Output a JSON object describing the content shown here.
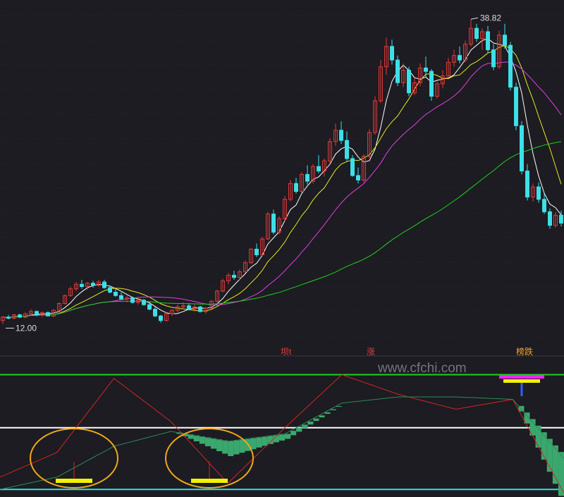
{
  "chart_data": [
    {
      "type": "candlestick",
      "title": "",
      "annotations": {
        "high_label": "38.82",
        "low_label": "12.00",
        "event_tags": [
          "坝t",
          "涨",
          "榜跌"
        ]
      },
      "ylim": [
        10,
        40
      ],
      "candles": [
        [
          12.2,
          12.6,
          11.9,
          12.5
        ],
        [
          12.5,
          12.7,
          12.3,
          12.4
        ],
        [
          12.4,
          12.8,
          12.3,
          12.7
        ],
        [
          12.7,
          12.8,
          12.4,
          12.5
        ],
        [
          12.5,
          12.9,
          12.4,
          12.8
        ],
        [
          12.8,
          13.2,
          12.6,
          13.0
        ],
        [
          13.0,
          13.1,
          12.6,
          12.7
        ],
        [
          12.7,
          13.0,
          12.5,
          12.9
        ],
        [
          12.9,
          13.0,
          12.6,
          12.6
        ],
        [
          12.6,
          13.2,
          12.5,
          13.1
        ],
        [
          13.1,
          13.8,
          13.0,
          13.7
        ],
        [
          13.7,
          14.5,
          13.6,
          14.4
        ],
        [
          14.4,
          15.2,
          14.3,
          15.0
        ],
        [
          15.0,
          15.6,
          14.8,
          15.4
        ],
        [
          15.4,
          15.8,
          15.0,
          15.2
        ],
        [
          15.2,
          15.6,
          14.9,
          15.5
        ],
        [
          15.5,
          15.7,
          15.1,
          15.3
        ],
        [
          15.3,
          15.8,
          15.2,
          15.6
        ],
        [
          15.6,
          15.8,
          15.0,
          15.1
        ],
        [
          15.1,
          15.3,
          14.6,
          14.7
        ],
        [
          14.7,
          15.0,
          14.3,
          14.4
        ],
        [
          14.4,
          14.7,
          14.0,
          14.1
        ],
        [
          14.1,
          14.4,
          13.8,
          14.2
        ],
        [
          14.2,
          14.3,
          13.7,
          13.8
        ],
        [
          13.8,
          14.2,
          13.6,
          14.0
        ],
        [
          14.0,
          14.1,
          13.5,
          13.6
        ],
        [
          13.6,
          13.9,
          13.1,
          13.2
        ],
        [
          13.2,
          13.4,
          12.5,
          12.6
        ],
        [
          12.6,
          12.7,
          12.0,
          12.2
        ],
        [
          12.2,
          12.9,
          12.1,
          12.8
        ],
        [
          12.8,
          13.2,
          12.6,
          13.1
        ],
        [
          13.1,
          13.6,
          12.9,
          13.4
        ],
        [
          13.4,
          13.8,
          13.2,
          13.5
        ],
        [
          13.5,
          13.7,
          13.1,
          13.2
        ],
        [
          13.2,
          13.6,
          13.0,
          13.4
        ],
        [
          13.4,
          13.5,
          12.9,
          13.0
        ],
        [
          13.0,
          13.4,
          12.8,
          13.3
        ],
        [
          13.3,
          14.0,
          13.2,
          13.9
        ],
        [
          13.9,
          14.9,
          13.8,
          14.8
        ],
        [
          14.8,
          15.9,
          14.7,
          15.7
        ],
        [
          15.7,
          16.4,
          15.4,
          16.2
        ],
        [
          16.2,
          16.6,
          15.8,
          16.0
        ],
        [
          16.0,
          16.7,
          15.8,
          16.5
        ],
        [
          16.5,
          17.5,
          16.4,
          17.3
        ],
        [
          17.3,
          18.6,
          17.2,
          18.5
        ],
        [
          18.5,
          19.0,
          17.8,
          18.0
        ],
        [
          18.0,
          19.6,
          17.9,
          19.4
        ],
        [
          19.4,
          21.8,
          19.3,
          21.6
        ],
        [
          21.6,
          22.0,
          19.8,
          20.0
        ],
        [
          20.0,
          21.4,
          19.8,
          21.2
        ],
        [
          21.2,
          23.2,
          21.0,
          22.9
        ],
        [
          22.9,
          24.6,
          22.7,
          24.3
        ],
        [
          24.3,
          24.8,
          23.4,
          23.6
        ],
        [
          23.6,
          25.3,
          23.5,
          25.1
        ],
        [
          25.1,
          25.9,
          24.2,
          24.5
        ],
        [
          24.5,
          26.0,
          24.3,
          25.8
        ],
        [
          25.8,
          26.8,
          25.2,
          25.4
        ],
        [
          25.4,
          26.5,
          24.9,
          26.3
        ],
        [
          26.3,
          28.3,
          26.1,
          28.0
        ],
        [
          28.0,
          29.6,
          27.6,
          29.0
        ],
        [
          29.0,
          29.8,
          27.8,
          28.1
        ],
        [
          28.1,
          28.9,
          26.2,
          26.5
        ],
        [
          26.5,
          26.8,
          24.9,
          25.0
        ],
        [
          25.0,
          25.7,
          24.3,
          24.6
        ],
        [
          24.6,
          26.9,
          24.4,
          26.7
        ],
        [
          26.7,
          29.1,
          26.5,
          28.8
        ],
        [
          28.8,
          32.0,
          28.6,
          31.6
        ],
        [
          31.6,
          35.2,
          31.4,
          34.6
        ],
        [
          34.6,
          37.2,
          33.9,
          36.4
        ],
        [
          36.4,
          37.0,
          34.8,
          35.2
        ],
        [
          35.2,
          35.6,
          32.9,
          33.2
        ],
        [
          33.2,
          34.9,
          32.8,
          34.3
        ],
        [
          34.3,
          34.6,
          32.0,
          32.3
        ],
        [
          32.3,
          33.6,
          32.1,
          33.2
        ],
        [
          33.2,
          34.9,
          32.9,
          34.5
        ],
        [
          34.5,
          35.5,
          33.7,
          34.2
        ],
        [
          34.2,
          34.4,
          31.6,
          32.0
        ],
        [
          32.0,
          33.3,
          31.8,
          33.1
        ],
        [
          33.1,
          34.3,
          32.7,
          33.8
        ],
        [
          33.8,
          35.4,
          33.6,
          35.0
        ],
        [
          35.0,
          36.1,
          34.6,
          35.6
        ],
        [
          35.6,
          36.4,
          34.9,
          35.2
        ],
        [
          35.2,
          36.9,
          35.0,
          36.6
        ],
        [
          36.6,
          38.8,
          36.4,
          38.0
        ],
        [
          38.0,
          38.4,
          36.8,
          37.1
        ],
        [
          37.1,
          38.0,
          36.1,
          37.7
        ],
        [
          37.7,
          38.2,
          35.8,
          36.1
        ],
        [
          36.1,
          36.6,
          34.3,
          34.6
        ],
        [
          34.6,
          37.8,
          34.4,
          37.4
        ],
        [
          37.4,
          38.4,
          36.2,
          36.5
        ],
        [
          36.5,
          36.8,
          32.5,
          32.8
        ],
        [
          32.8,
          33.2,
          29.0,
          29.4
        ],
        [
          29.4,
          29.8,
          25.1,
          25.4
        ],
        [
          25.4,
          26.0,
          22.8,
          23.1
        ],
        [
          23.1,
          24.3,
          22.7,
          24.0
        ],
        [
          24.0,
          24.4,
          22.6,
          22.9
        ],
        [
          22.9,
          23.4,
          21.6,
          21.8
        ],
        [
          21.8,
          22.1,
          20.3,
          20.6
        ],
        [
          20.6,
          21.8,
          20.4,
          21.5
        ],
        [
          21.5,
          21.9,
          20.5,
          20.8
        ]
      ]
    },
    {
      "type": "line",
      "title": "",
      "ylim": [
        0,
        100
      ],
      "x": [
        0,
        10,
        20,
        30,
        40,
        50,
        60,
        70,
        80,
        90,
        99
      ],
      "series": [
        {
          "values": [
            15,
            35,
            95,
            60,
            10,
            55,
            98,
            82,
            70,
            78,
            2
          ]
        },
        {
          "values": [
            5,
            15,
            40,
            52,
            44,
            50,
            75,
            80,
            80,
            78,
            30
          ]
        }
      ],
      "bars": {
        "values": [
          0,
          0,
          0,
          0,
          -12,
          -4,
          0,
          0,
          0,
          0,
          -40
        ]
      },
      "reference_lines": [
        {
          "value": 98,
          "color": "#1fd11f"
        },
        {
          "value": 55,
          "color": "#ffffff"
        },
        {
          "value": 5,
          "color": "#2be0e0"
        }
      ]
    }
  ],
  "watermark": "www.cfchi.com",
  "colors": {
    "background": "#1c1c22",
    "candle_up": "#e03a3a",
    "candle_down": "#3ee0e8",
    "ma5": "#ffffff",
    "ma10": "#e8e820",
    "ma20": "#e040e0",
    "ma60": "#20d020",
    "circle": "#f0a818",
    "bar_green": "#3aa86e",
    "marker_yellow": "#f2f200",
    "marker_magenta": "#ff20ff",
    "marker_blue": "#3060ff"
  }
}
